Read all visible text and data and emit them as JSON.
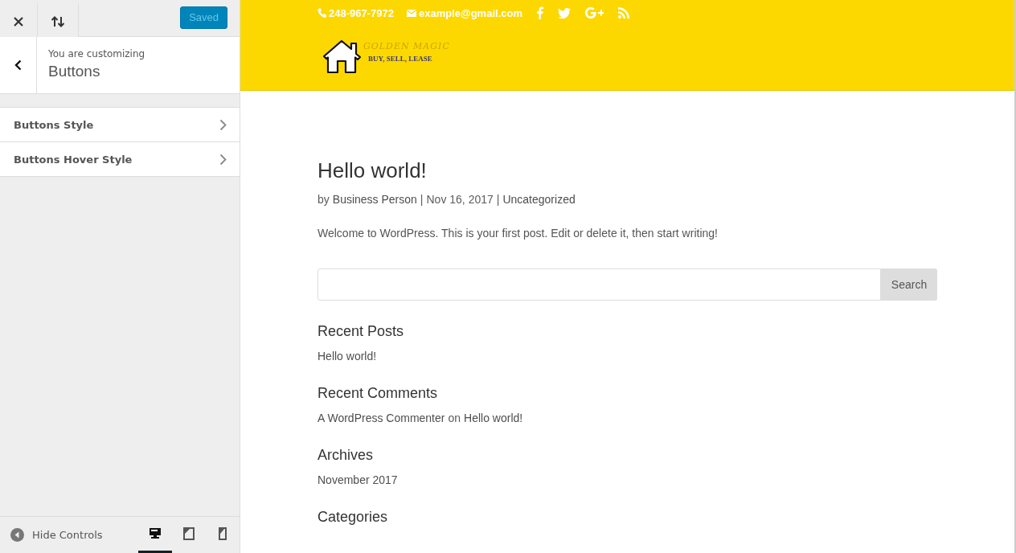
{
  "sidebar": {
    "save_button": "Saved",
    "header_label": "You are customizing",
    "header_title": "Buttons",
    "sections": [
      {
        "label": "Buttons Style"
      },
      {
        "label": "Buttons Hover Style"
      }
    ],
    "footer": {
      "hide_label": "Hide Controls",
      "devices": [
        {
          "kind": "desktop",
          "selected": true
        },
        {
          "kind": "tablet",
          "selected": false
        },
        {
          "kind": "mobile",
          "selected": false
        }
      ]
    }
  },
  "preview": {
    "topbar": {
      "phone": "248-967-7972",
      "email": "example@gmail.com",
      "social": [
        {
          "kind": "facebook"
        },
        {
          "kind": "twitter"
        },
        {
          "kind": "google-plus"
        },
        {
          "kind": "rss"
        }
      ]
    },
    "logo": {
      "title": "GOLDEN MAGIC",
      "tagline": "BUY, SELL, LEASE"
    },
    "post": {
      "title": "Hello world!",
      "meta": [
        {
          "kind": "text",
          "text": "by"
        },
        {
          "kind": "link",
          "text": "Business Person"
        },
        {
          "kind": "text",
          "text": "|"
        },
        {
          "kind": "text",
          "text": "Nov 16, 2017"
        },
        {
          "kind": "text",
          "text": "|"
        },
        {
          "kind": "link",
          "text": "Uncategorized"
        }
      ],
      "body": "Welcome to WordPress. This is your first post. Edit or delete it, then start writing!"
    },
    "search_button": "Search",
    "widgets": [
      {
        "title": "Recent Posts",
        "items": [
          {
            "parts": [
              {
                "text": "Hello world!",
                "kind": "link"
              }
            ]
          }
        ]
      },
      {
        "title": "Recent Comments",
        "items": [
          {
            "parts": [
              {
                "text": "A WordPress Commenter",
                "kind": "link"
              },
              {
                "text": "on",
                "kind": "text"
              },
              {
                "text": "Hello world!",
                "kind": "link"
              }
            ]
          }
        ]
      },
      {
        "title": "Archives",
        "items": [
          {
            "parts": [
              {
                "text": "November 2017",
                "kind": "link"
              }
            ]
          }
        ]
      },
      {
        "title": "Categories"
      }
    ]
  }
}
